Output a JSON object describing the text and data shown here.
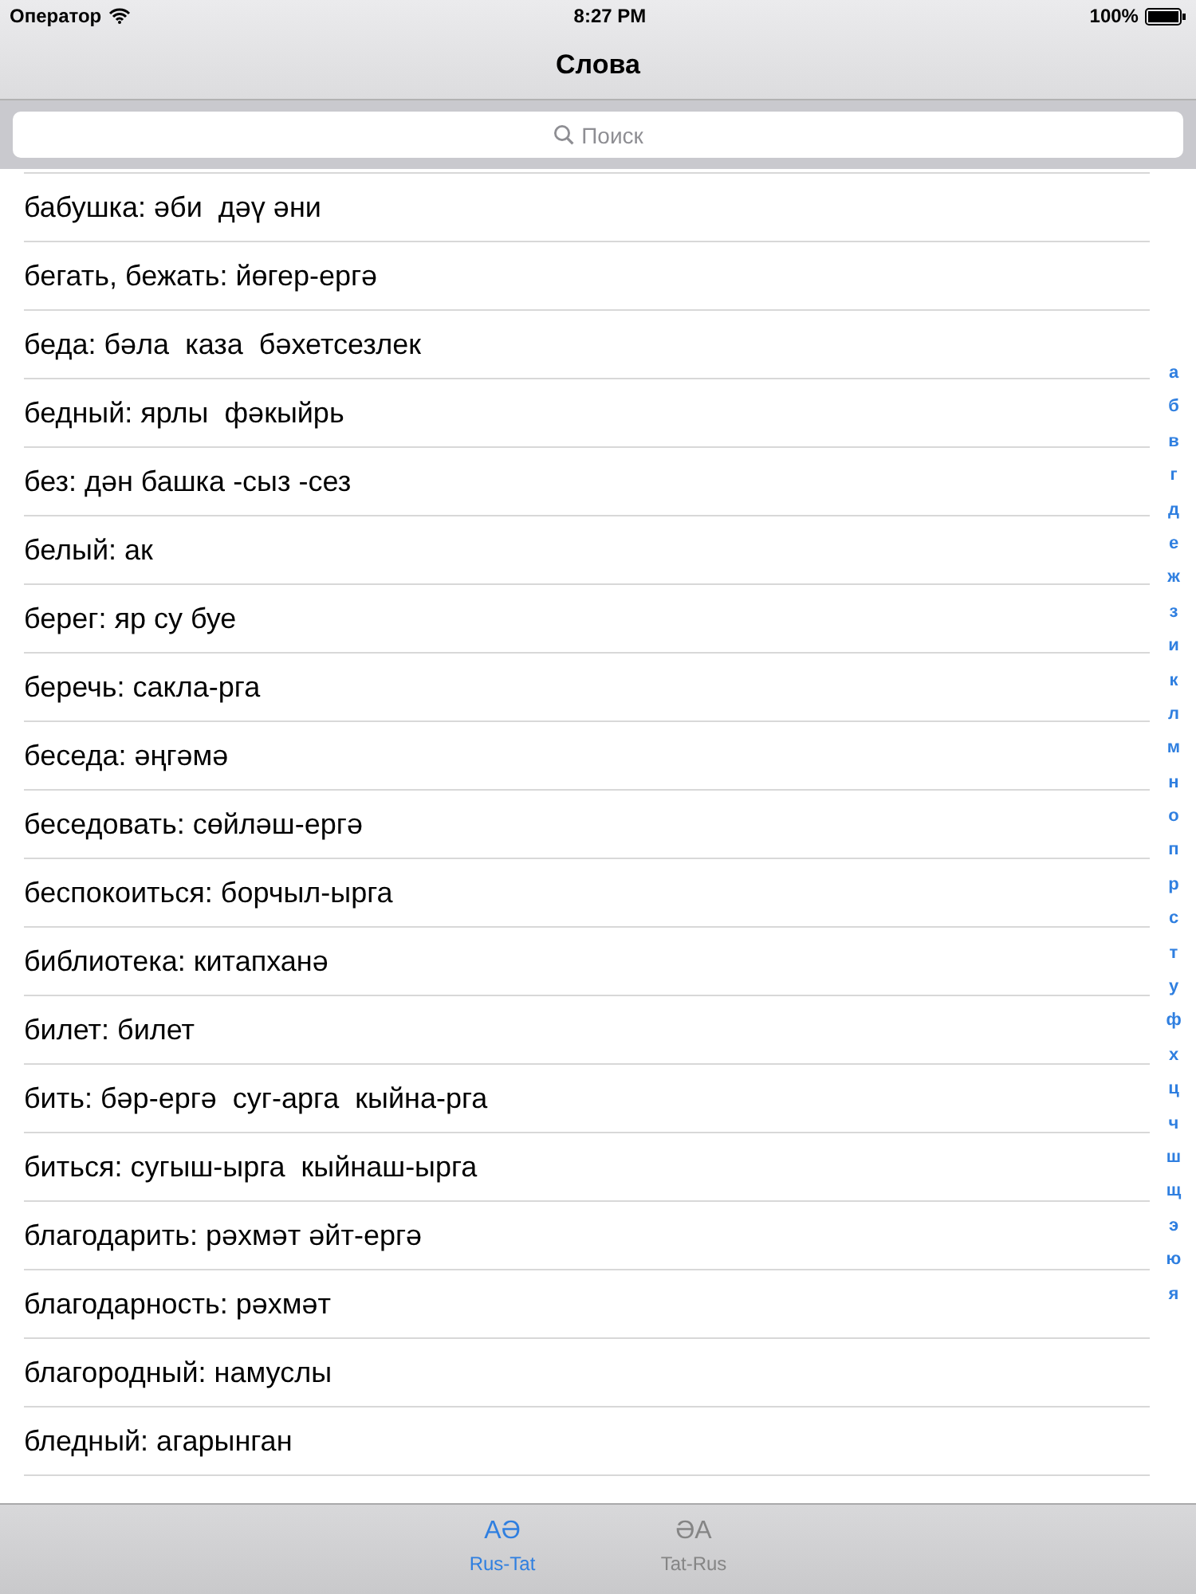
{
  "status_bar": {
    "carrier": "Оператор",
    "time": "8:27 PM",
    "battery": "100%"
  },
  "nav_bar": {
    "title": "Слова"
  },
  "search": {
    "placeholder": "Поиск"
  },
  "rows": [
    "бабушка: әби  дәү әни",
    "бегать, бежать: йөгер-ергә",
    "беда: бәла  каза  бәхетсезлек",
    "бедный: ярлы  фәкыйрь",
    "без: дән башка -сыз -сез",
    "белый: ак",
    "берег: яр су буе",
    "беречь: сакла-рга",
    "беседа: әңгәмә",
    "беседовать: сөйләш-ергә",
    "беспокоиться: борчыл-ырга",
    "библиотека: китапханә",
    "билет: билет",
    "бить: бәр-ергә  суг-арга  кыйна-рга",
    "биться: сугыш-ырга  кыйнаш-ырга",
    "благодарить: рәхмәт әйт-ергә",
    "благодарность: рәхмәт",
    "благородный: намуслы",
    "бледный: агарынган"
  ],
  "index": [
    "а",
    "б",
    "в",
    "г",
    "д",
    "е",
    "ж",
    "з",
    "и",
    "к",
    "л",
    "м",
    "н",
    "о",
    "п",
    "р",
    "с",
    "т",
    "у",
    "ф",
    "х",
    "ц",
    "ч",
    "ш",
    "щ",
    "э",
    "ю",
    "я"
  ],
  "tabs": [
    {
      "glyph": "AӘ",
      "label": "Rus-Tat",
      "selected": true
    },
    {
      "glyph": "ӘA",
      "label": "Tat-Rus",
      "selected": false
    }
  ]
}
